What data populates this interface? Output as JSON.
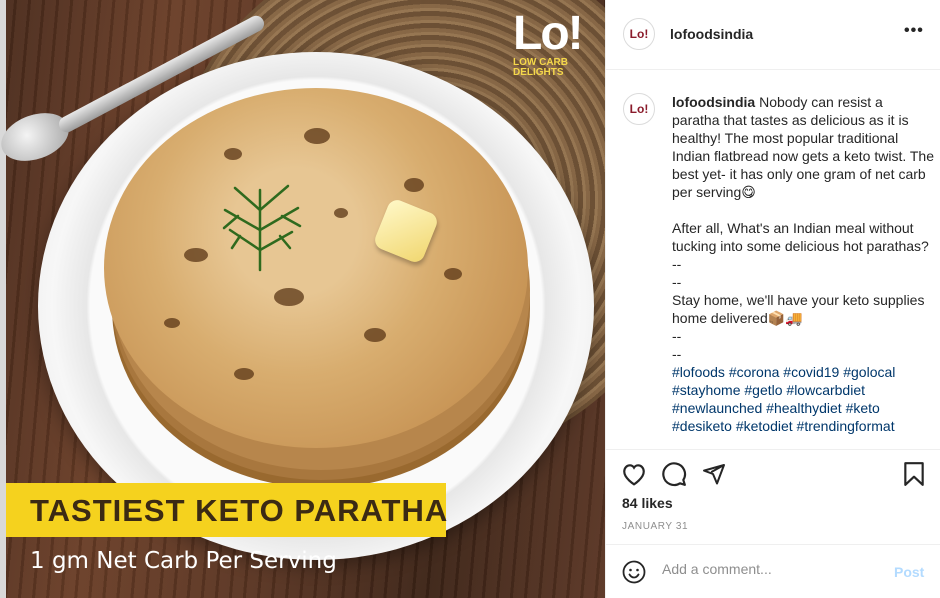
{
  "post": {
    "image": {
      "logo_main": "Lo!",
      "logo_sub_line1": "LOW CARB",
      "logo_sub_line2": "DELIGHTS",
      "banner_title": "TASTIEST KETO PARATHA",
      "banner_subtitle": "1 gm Net Carb Per Serving",
      "banner_color": "#f5d21e"
    },
    "header": {
      "avatar_text": "Lo!",
      "username": "lofoodsindia",
      "more_icon": "more-options-icon",
      "more_glyph": "•••"
    },
    "caption": {
      "avatar_text": "Lo!",
      "username": "lofoodsindia",
      "text": " Nobody can resist a paratha that tastes as delicious as it is healthy! The most popular traditional Indian flatbread now gets a keto twist. The best yet- it has only one gram of net carb per serving😋\n\nAfter all, What's an Indian meal without tucking into some delicious hot parathas?\n--\n--\nStay home, we'll have your keto supplies home delivered📦🚚\n--\n--\n",
      "hashtags": "#lofoods #corona #covid19 #golocal #stayhome #getlo #lowcarbdiet #newlaunched #healthydiet #keto #desiketo #ketodiet #trendingformat"
    },
    "actions": {
      "like_icon": "heart-icon",
      "comment_icon": "comment-icon",
      "share_icon": "share-icon",
      "save_icon": "bookmark-icon"
    },
    "likes": "84 likes",
    "date": "JANUARY 31",
    "comment": {
      "emoji_icon": "smiley-icon",
      "placeholder": "Add a comment...",
      "post_label": "Post",
      "post_color": "#b3dbff"
    }
  }
}
